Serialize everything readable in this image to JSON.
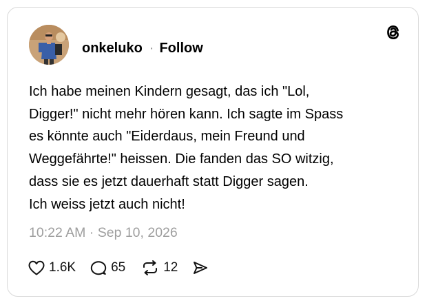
{
  "post": {
    "username": "onkeluko",
    "separator": "·",
    "follow_label": "Follow",
    "text_lines": [
      "Ich habe meinen Kindern gesagt, das ich \"Lol,",
      "Digger!\" nicht mehr hören kann. Ich sagte im Spass",
      "es könnte auch \"Eiderdaus, mein Freund und",
      "Weggefährte!\" heissen. Die fanden das SO witzig,",
      "dass sie es jetzt dauerhaft statt Digger sagen.",
      "Ich weiss jetzt auch nicht!"
    ],
    "timestamp": "10:22 AM · Sep 10, 2026",
    "stats": {
      "likes": "1.6K",
      "replies": "65",
      "reposts": "12"
    }
  },
  "icons": {
    "logo": "threads-logo-icon",
    "like": "heart-icon",
    "reply": "comment-bubble-icon",
    "repost": "repost-arrows-icon",
    "share": "share-send-icon"
  },
  "colors": {
    "text": "#000000",
    "muted": "#9e9e9e",
    "border": "#d9d9d9",
    "background": "#ffffff"
  }
}
